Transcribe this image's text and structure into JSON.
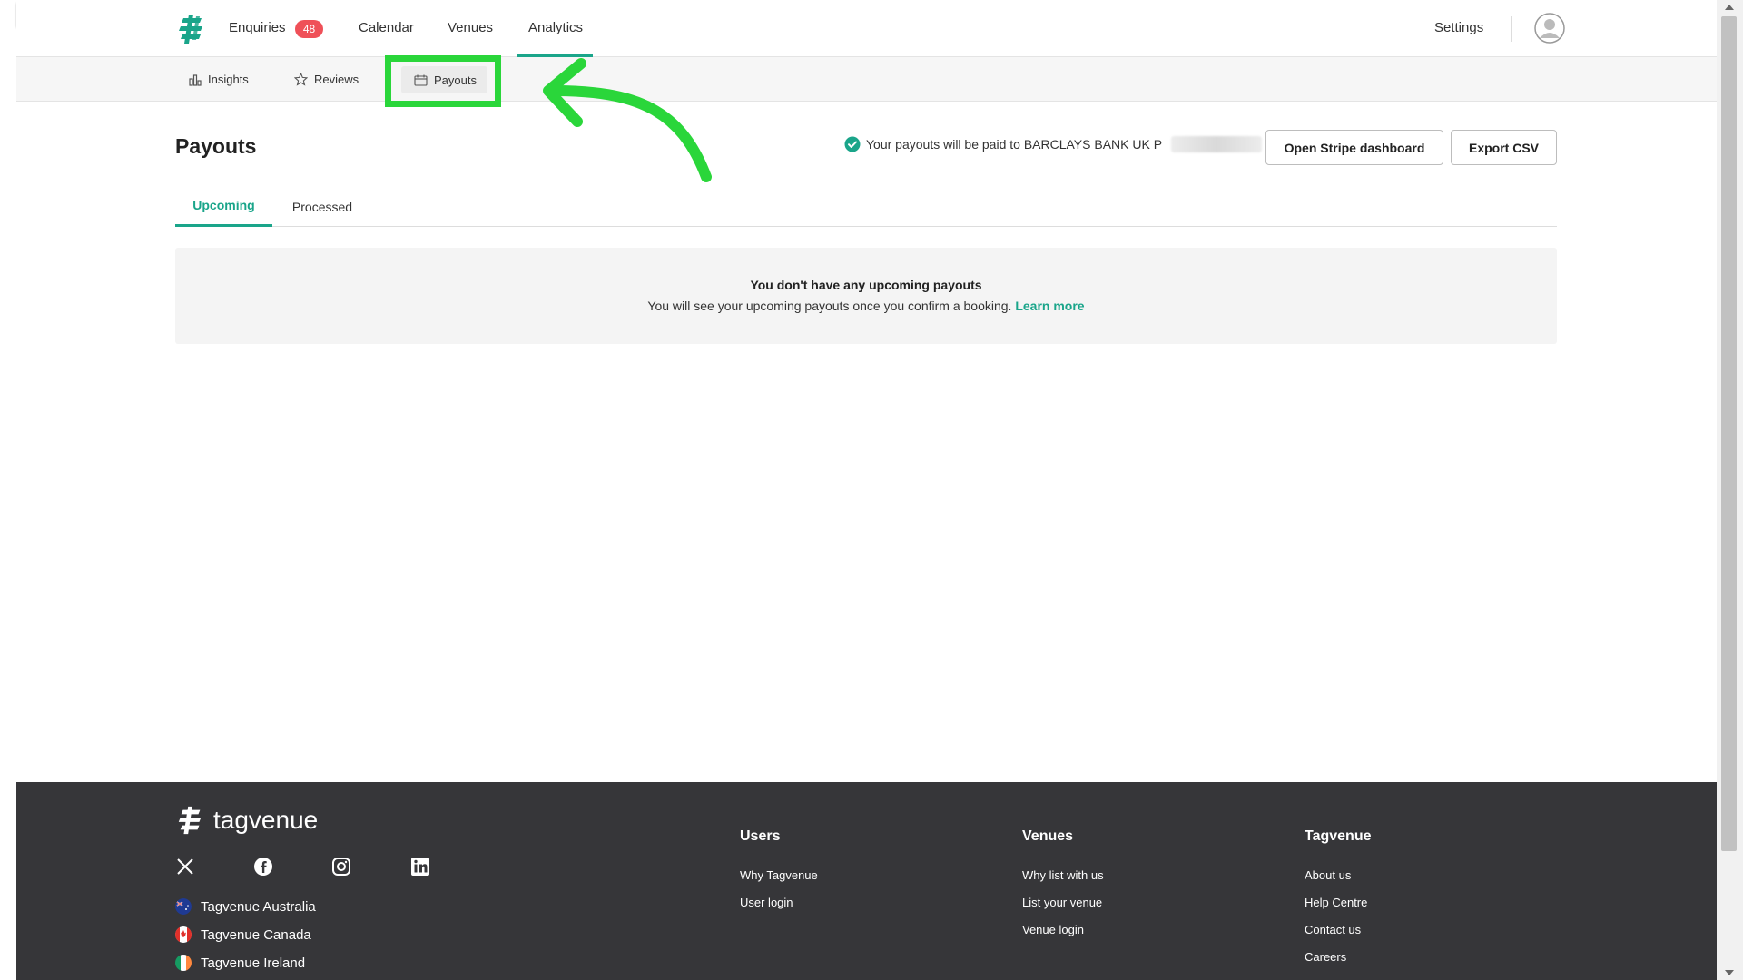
{
  "nav": {
    "enquiries": "Enquiries",
    "enquiries_badge": "48",
    "calendar": "Calendar",
    "venues": "Venues",
    "analytics": "Analytics",
    "settings": "Settings"
  },
  "subnav": {
    "insights": "Insights",
    "reviews": "Reviews",
    "payouts": "Payouts"
  },
  "main": {
    "title": "Payouts",
    "payout_info": "Your payouts will be paid to BARCLAYS BANK UK P",
    "open_stripe": "Open Stripe dashboard",
    "export_csv": "Export CSV",
    "tabs": [
      "Upcoming",
      "Processed"
    ],
    "empty_title": "You don't have any upcoming payouts",
    "empty_text": "You will see your upcoming payouts once you confirm a booking.",
    "learn_more": "Learn more"
  },
  "footer": {
    "brand": "tagvenue",
    "countries": [
      "Tagvenue Australia",
      "Tagvenue Canada",
      "Tagvenue Ireland"
    ],
    "users": {
      "title": "Users",
      "links": [
        "Why Tagvenue",
        "User login"
      ]
    },
    "venues": {
      "title": "Venues",
      "links": [
        "Why list with us",
        "List your venue",
        "Venue login"
      ]
    },
    "tagvenue": {
      "title": "Tagvenue",
      "links": [
        "About us",
        "Help Centre",
        "Contact us",
        "Careers"
      ]
    }
  },
  "colors": {
    "accent": "#1aa58a",
    "badge": "#ef5058",
    "highlight": "#2ad63a",
    "footer_bg": "#363639"
  },
  "icons": [
    "tagvenue-logo-icon",
    "insights-icon",
    "reviews-star-icon",
    "payouts-icon",
    "check-circle-icon",
    "avatar-icon",
    "x-icon",
    "facebook-icon",
    "instagram-icon",
    "linkedin-icon",
    "arrow-annotation"
  ]
}
